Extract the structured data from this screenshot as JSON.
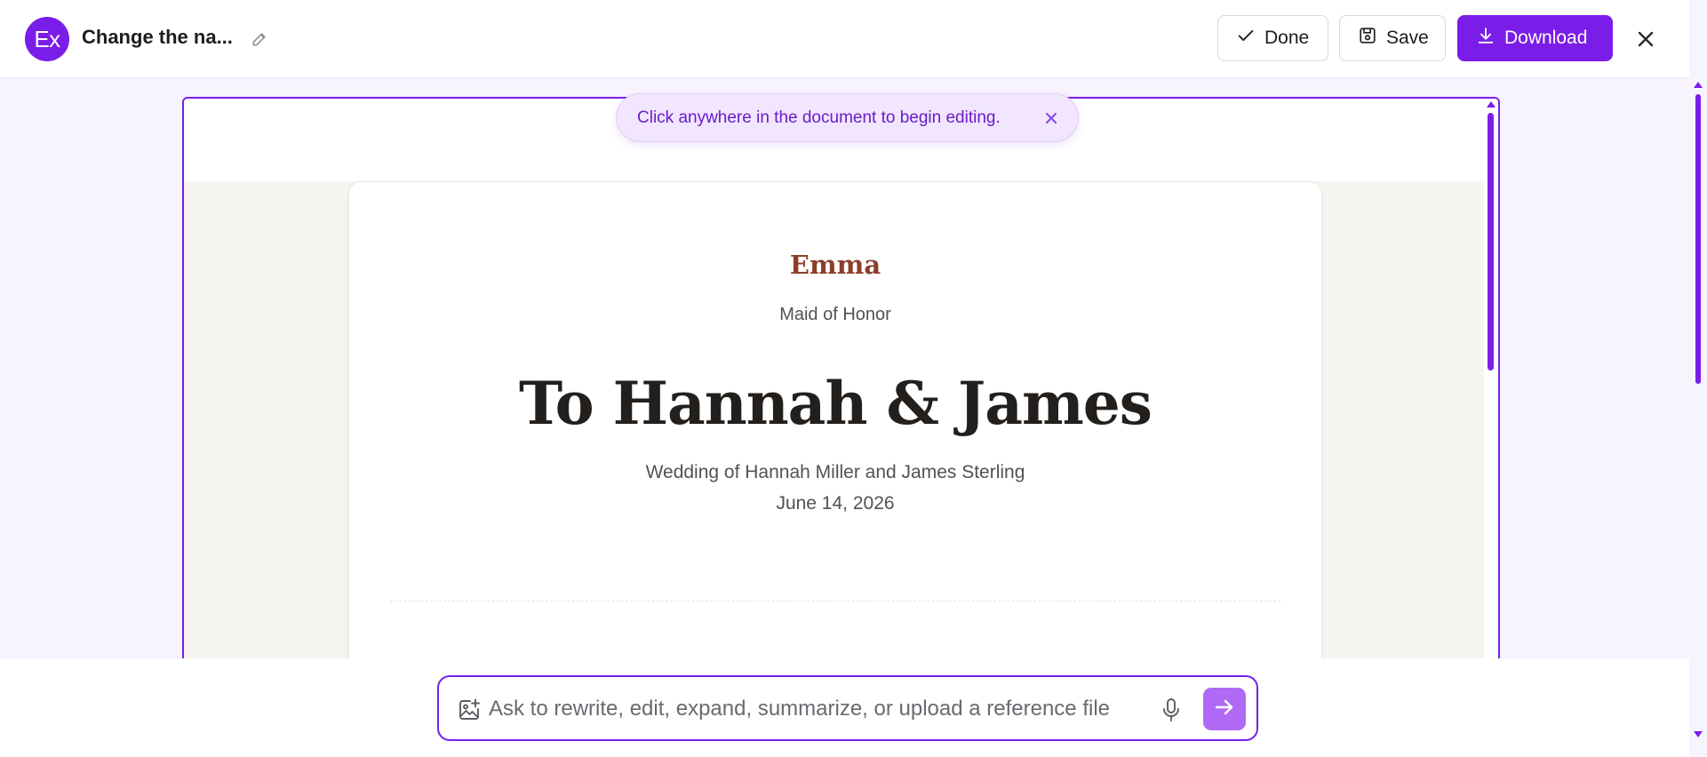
{
  "header": {
    "avatar_initials": "Ex",
    "title": "Change the na...",
    "buttons": {
      "done": "Done",
      "save": "Save",
      "download": "Download"
    }
  },
  "toast": {
    "message": "Click anywhere in the document to begin editing."
  },
  "document": {
    "author": "Emma",
    "role": "Maid of Honor",
    "headline": "To Hannah & James",
    "subtitle": "Wedding of Hannah Miller and James Sterling",
    "date": "June 14, 2026"
  },
  "prompt": {
    "placeholder": "Ask to rewrite, edit, expand, summarize, or upload a reference file",
    "value": ""
  },
  "icons": {
    "edit": "pencil-icon",
    "done": "check-icon",
    "save": "floppy-disk-icon",
    "download": "download-icon",
    "close": "close-icon",
    "attach_image": "image-add-icon",
    "voice": "microphone-icon",
    "send": "arrow-right-icon"
  },
  "colors": {
    "accent": "#7a1de8",
    "send_button": "#b069f5",
    "author_name": "#8a3f2c",
    "toast_background": "#f1e6fd"
  }
}
